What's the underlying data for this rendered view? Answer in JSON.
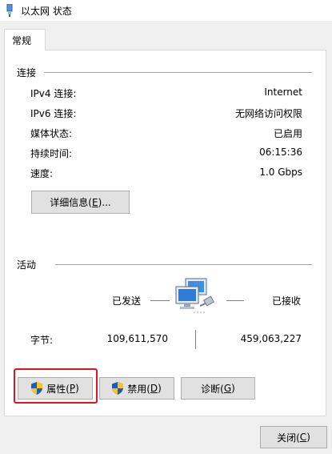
{
  "window": {
    "title": "以太网 状态"
  },
  "tabs": [
    {
      "label": "常规"
    }
  ],
  "connection": {
    "header": "连接",
    "rows": [
      {
        "label": "IPv4 连接:",
        "value": "Internet"
      },
      {
        "label": "IPv6 连接:",
        "value": "无网络访问权限"
      },
      {
        "label": "媒体状态:",
        "value": "已启用"
      },
      {
        "label": "持续时间:",
        "value": "06:15:36"
      },
      {
        "label": "速度:",
        "value": "1.0 Gbps"
      }
    ],
    "details_button": {
      "text": "详细信息(",
      "key": "E",
      "suffix": ")..."
    }
  },
  "activity": {
    "header": "活动",
    "sent_label": "已发送",
    "received_label": "已接收",
    "bytes_label": "字节:",
    "bytes_sent": "109,611,570",
    "bytes_received": "459,063,227"
  },
  "buttons": {
    "properties": {
      "text": "属性(",
      "key": "P",
      "suffix": ")"
    },
    "disable": {
      "text": "禁用(",
      "key": "D",
      "suffix": ")"
    },
    "diagnose": {
      "text": "诊断(",
      "key": "G",
      "suffix": ")"
    },
    "close": {
      "text": "关闭(",
      "key": "C",
      "suffix": ")"
    }
  },
  "colors": {
    "highlight_border": "#e81123",
    "shield_blue": "#1e5bb8",
    "shield_yellow": "#f3c623"
  },
  "icons": {
    "window": "network-adapter-icon",
    "activity": "network-computers-icon",
    "shield": "uac-shield-icon"
  }
}
